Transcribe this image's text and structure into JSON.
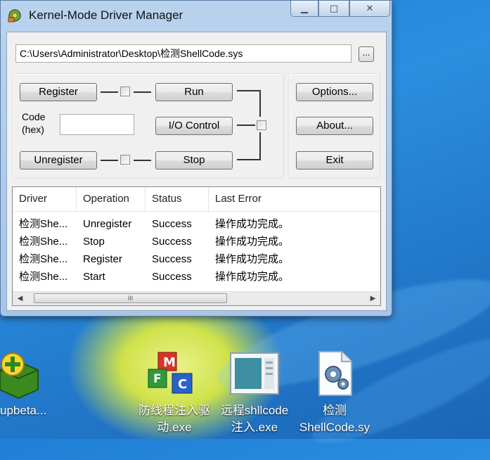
{
  "window": {
    "title": "Kernel-Mode Driver Manager",
    "buttons": {
      "minimize": "▁",
      "maximize": "□",
      "close": "✕"
    }
  },
  "path": {
    "value": "C:\\Users\\Administrator\\Desktop\\检测ShellCode.sys",
    "browse_label": "..."
  },
  "controls": {
    "register": "Register",
    "run": "Run",
    "code_label_line1": "Code",
    "code_label_line2": "(hex)",
    "code_value": "",
    "io_control": "I/O Control",
    "unregister": "Unregister",
    "stop": "Stop",
    "options": "Options...",
    "about": "About...",
    "exit": "Exit"
  },
  "list": {
    "columns": [
      "Driver",
      "Operation",
      "Status",
      "Last Error"
    ],
    "rows": [
      [
        "检测She...",
        "Unregister",
        "Success",
        "操作成功完成。"
      ],
      [
        "检测She...",
        "Stop",
        "Success",
        "操作成功完成。"
      ],
      [
        "检测She...",
        "Register",
        "Success",
        "操作成功完成。"
      ],
      [
        "检测She...",
        "Start",
        "Success",
        "操作成功完成。"
      ]
    ],
    "scroll_grip": "III"
  },
  "desktop": {
    "icons": [
      {
        "name": "upbeta...",
        "icon": "green-plus-box-icon"
      },
      {
        "name_line1": "防线程注入驱",
        "name_line2": "动.exe",
        "icon": "mfc-cubes-icon"
      },
      {
        "name_line1": "远程shllcode",
        "name_line2": "注入.exe",
        "icon": "app-window-icon"
      },
      {
        "name_line1": "检测",
        "name_line2": "ShellCode.sy",
        "icon": "gear-file-icon"
      }
    ]
  },
  "colors": {
    "desktop_blue": "#2b8fe0",
    "window_frame": "#b9d3ee",
    "close_red": "#c9463d"
  }
}
